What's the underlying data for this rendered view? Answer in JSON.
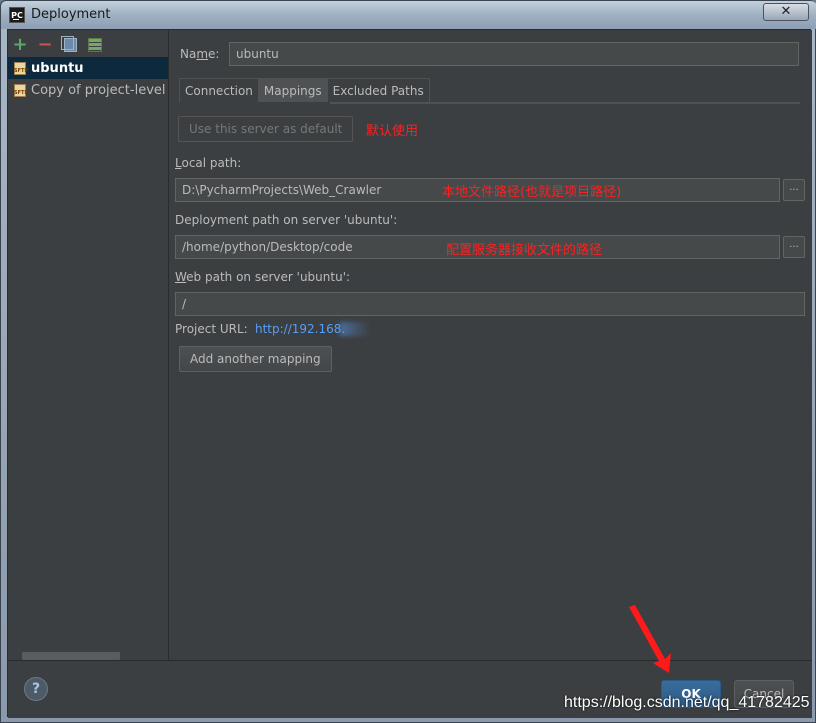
{
  "window": {
    "title": "Deployment",
    "app_icon": "PC",
    "close_glyph": "✕"
  },
  "toolbar": {
    "icons": [
      "plus-icon",
      "minus-icon",
      "copy-icon",
      "set-default-icon"
    ]
  },
  "servers": [
    {
      "label": "ubuntu",
      "selected": true
    },
    {
      "label": "Copy of project-level se",
      "selected": false
    }
  ],
  "form": {
    "name_label": "Name:",
    "name_value": "ubuntu",
    "tabs": [
      {
        "label": "Connection",
        "active": false
      },
      {
        "label": "Mappings",
        "active": true
      },
      {
        "label": "Excluded Paths",
        "active": false
      }
    ],
    "use_default_button": "Use this server as default",
    "local_path_label": "Local path:",
    "local_path_value": "D:\\PycharmProjects\\Web_Crawler",
    "deployment_path_label": "Deployment path on server 'ubuntu':",
    "deployment_path_value": "/home/python/Desktop/code",
    "web_path_label": "Web path on server 'ubuntu':",
    "web_path_value": "/",
    "project_url_label": "Project URL:",
    "project_url_value": "http://192.168.",
    "add_mapping_button": "Add another mapping",
    "browse_glyph": "..."
  },
  "annotations": {
    "default_note": "默认使用",
    "local_note": "本地文件路径(也就是项目路径)",
    "remote_note": "配置服务器接收文件的路径"
  },
  "footer": {
    "help_glyph": "?",
    "ok_label": "OK",
    "cancel_label": "Cancel"
  },
  "watermark": "https://blog.csdn.net/qq_41782425",
  "colors": {
    "background": "#3c3f41",
    "selection": "#0d293e",
    "link": "#589df6",
    "annotation": "#ff2020",
    "ok_button": "#2c5a86"
  }
}
